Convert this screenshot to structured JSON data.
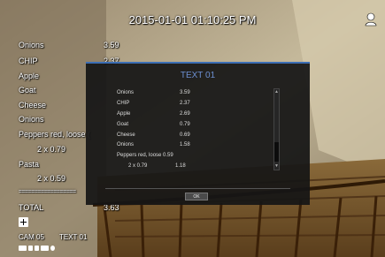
{
  "osd": {
    "timestamp": "2015-01-01 01:10:25 PM",
    "camera_name": "CAM 05",
    "camera_text": "TEXT 01"
  },
  "receipt_overlay": {
    "items": [
      {
        "name": "Onions",
        "price": "3.59"
      },
      {
        "name": "CHIP",
        "price": "2.37"
      },
      {
        "name": "Apple",
        "price": ""
      },
      {
        "name": "Goat",
        "price": ""
      },
      {
        "name": "Cheese",
        "price": ""
      },
      {
        "name": "Onions",
        "price": ""
      },
      {
        "name": "Peppers red, loose (",
        "price": ""
      },
      {
        "name": "2 x 0.79",
        "price": ""
      },
      {
        "name": "Pasta",
        "price": ""
      },
      {
        "name": "2 x 0.59",
        "price": ""
      }
    ],
    "divider": "==================",
    "total_label": "TOTAL",
    "total_value": "3.63"
  },
  "dialog": {
    "title": "TEXT 01",
    "lines": [
      {
        "name": "Onions",
        "price": "3.59"
      },
      {
        "name": "CHIP",
        "price": "2.37"
      },
      {
        "name": "Apple",
        "price": "2.69"
      },
      {
        "name": "Goat",
        "price": "0.79"
      },
      {
        "name": "Cheese",
        "price": "0.69"
      },
      {
        "name": "Onions",
        "price": "1.58"
      },
      {
        "name": "Peppers red, loose 0.59",
        "price": ""
      },
      {
        "name": "2 x 0.79",
        "price": "1.18"
      }
    ],
    "ok_label": "OK",
    "scroll_up_glyph": "▲",
    "scroll_down_glyph": "▼"
  },
  "icons": {
    "user": "user-icon",
    "plus": "plus-icon",
    "status": [
      "record-icon",
      "audio-icon",
      "motion-icon",
      "event-icon",
      "alarm-icon"
    ]
  },
  "colors": {
    "dialog_title": "#6c8fd0",
    "dialog_border": "#3c6eb4"
  }
}
